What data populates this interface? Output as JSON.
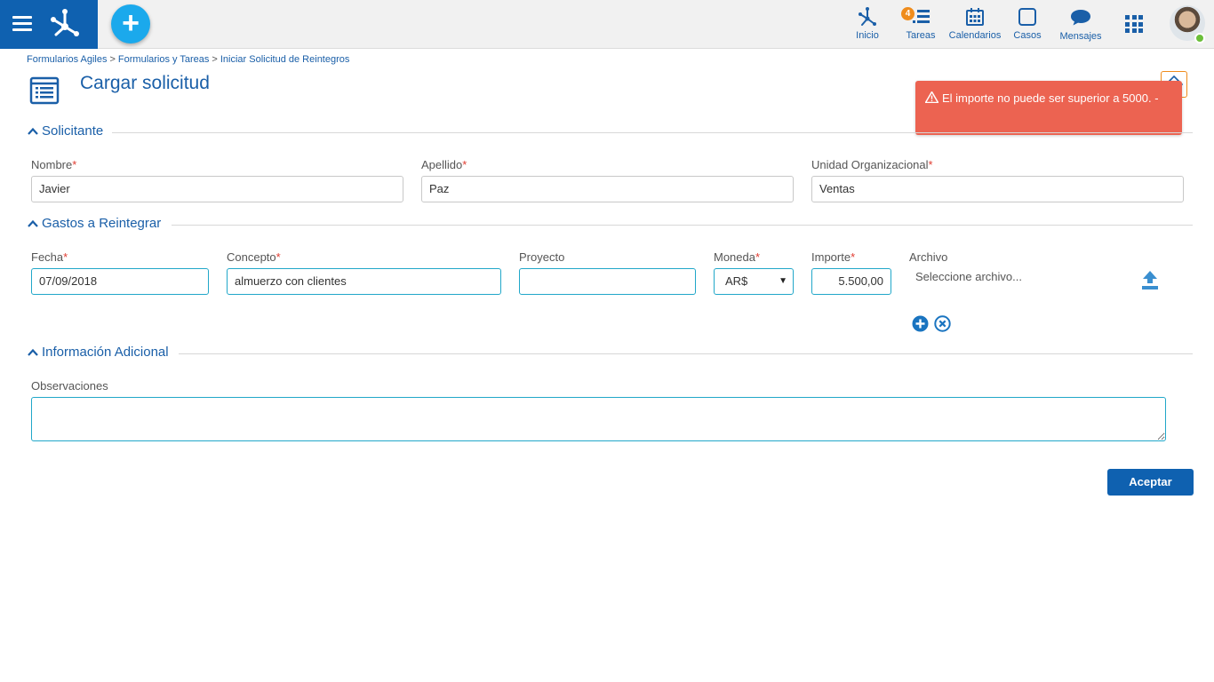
{
  "topbar": {
    "nav": {
      "inicio": "Inicio",
      "tareas": "Tareas",
      "tareas_badge": "4",
      "calendarios": "Calendarios",
      "casos": "Casos",
      "mensajes": "Mensajes"
    },
    "add_label": "+"
  },
  "breadcrumb": {
    "items": [
      "Formularios Agiles",
      "Formularios y Tareas",
      "Iniciar Solicitud de Reintegros"
    ],
    "separator": ">"
  },
  "page": {
    "title": "Cargar solicitud"
  },
  "toast": {
    "message": "El importe no puede ser superior a 5000. -",
    "color": "#ec6351"
  },
  "sections": {
    "solicitante": {
      "title": "Solicitante",
      "nombre_label": "Nombre",
      "nombre_value": "Javier",
      "apellido_label": "Apellido",
      "apellido_value": "Paz",
      "unidad_label": "Unidad Organizacional",
      "unidad_value": "Ventas"
    },
    "gastos": {
      "title": "Gastos a Reintegrar",
      "fecha_label": "Fecha",
      "fecha_value": "07/09/2018",
      "concepto_label": "Concepto",
      "concepto_value": "almuerzo con clientes",
      "proyecto_label": "Proyecto",
      "proyecto_value": "",
      "moneda_label": "Moneda",
      "moneda_value": "AR$",
      "importe_label": "Importe",
      "importe_value": "5.500,00",
      "archivo_label": "Archivo",
      "archivo_placeholder": "Seleccione archivo..."
    },
    "info": {
      "title": "Información Adicional",
      "observaciones_label": "Observaciones",
      "observaciones_value": ""
    }
  },
  "actions": {
    "accept_label": "Aceptar"
  },
  "required_marker": "*",
  "colors": {
    "primary": "#0f61b0",
    "accent": "#1ba9ec",
    "error": "#ec6351",
    "badge": "#ef8c1c"
  }
}
